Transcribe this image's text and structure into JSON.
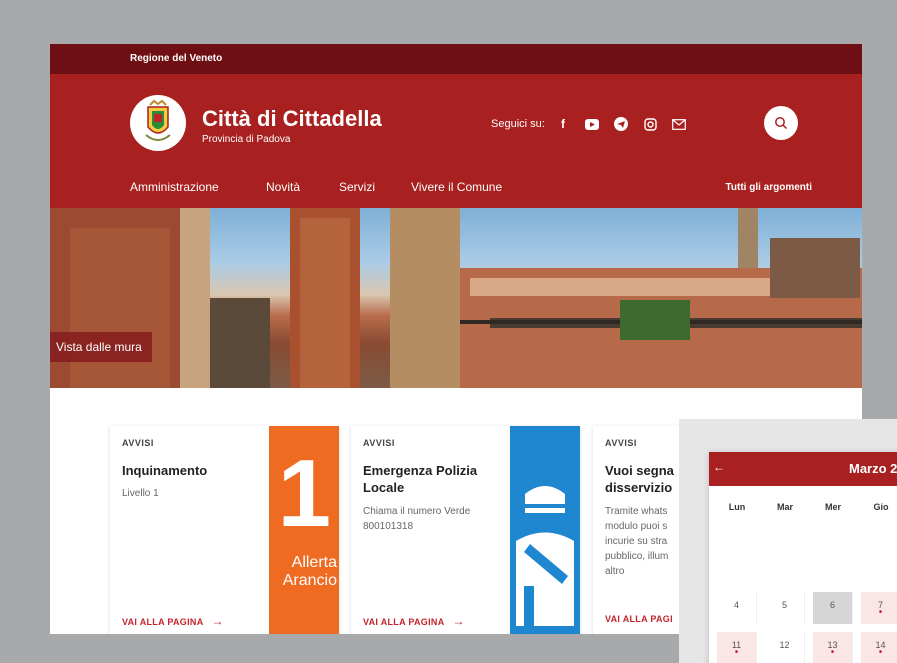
{
  "topbar": {
    "region": "Regione del Veneto"
  },
  "header": {
    "title": "Città di Cittadella",
    "subtitle": "Provincia di Padova",
    "social_label": "Seguici su:",
    "social_icons": [
      "facebook-icon",
      "youtube-icon",
      "telegram-icon",
      "instagram-icon",
      "mail-icon"
    ]
  },
  "nav": {
    "items": [
      "Amministrazione",
      "Novità",
      "Servizi",
      "Vivere il Comune"
    ],
    "all_topics": "Tutti gli argomenti"
  },
  "hero": {
    "caption": "Vista dalle mura"
  },
  "cards": [
    {
      "kicker": "AVVISI",
      "title": "Inquinamento",
      "text": "Livello 1",
      "link": "VAI ALLA PAGINA",
      "badge_number": "1",
      "badge_text_1": "Allerta",
      "badge_text_2": "Arancio"
    },
    {
      "kicker": "AVVISI",
      "title_1": "Emergenza Polizia",
      "title_2": "Locale",
      "text_1": "Chiama il numero Verde",
      "text_2": "800101318",
      "link": "VAI ALLA PAGINA"
    },
    {
      "kicker": "AVVISI",
      "title_1": "Vuoi segna",
      "title_2": "disservizio",
      "text_lines": [
        "Tramite whats",
        "modulo puoi s",
        "incurie su stra",
        "pubblico, illum",
        "altro"
      ],
      "link": "VAI ALLA PAGI"
    }
  ],
  "calendar": {
    "back": "←",
    "month": "Marzo 2",
    "weekdays": [
      "Lun",
      "Mar",
      "Mer",
      "Gio"
    ],
    "row1": [
      "4",
      "5",
      "6",
      "7"
    ],
    "row2": [
      "11",
      "12",
      "13",
      "14"
    ]
  },
  "colors": {
    "brand": "#a8201f",
    "topbar": "#6e0f14",
    "alert_orange": "#f06b22",
    "police_blue": "#1f86d0"
  }
}
